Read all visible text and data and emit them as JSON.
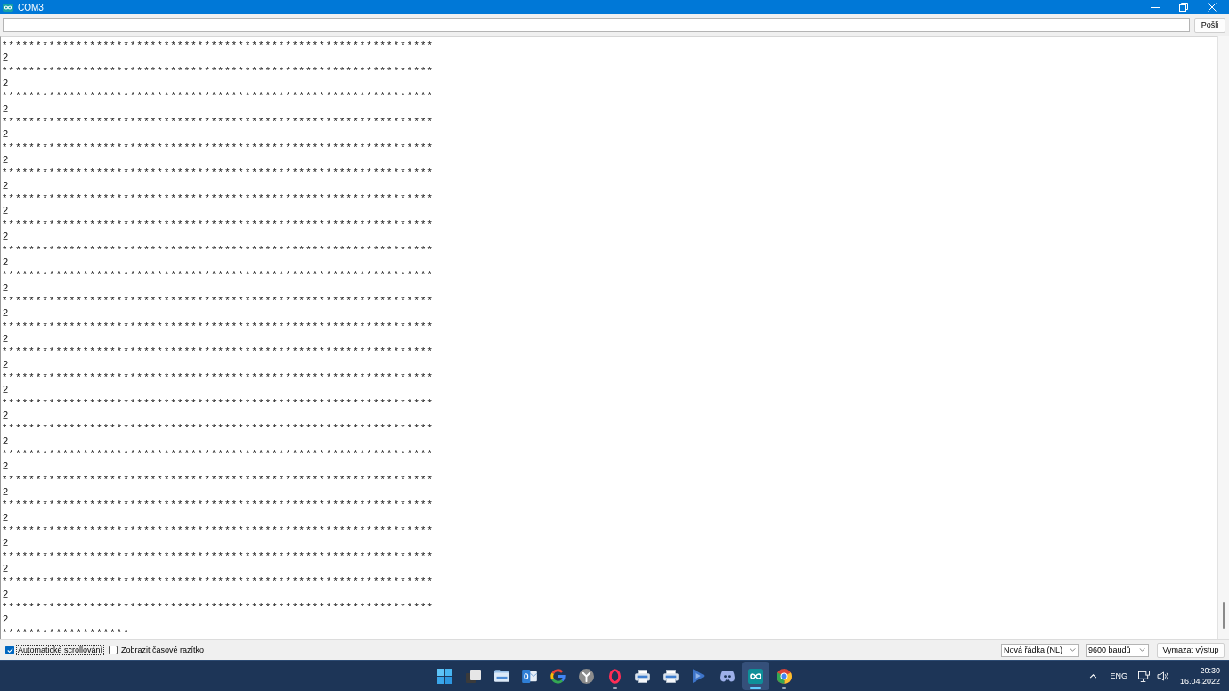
{
  "window": {
    "title": "COM3"
  },
  "send_bar": {
    "button": "Pošli"
  },
  "output": {
    "lines": [
      "****************************************************************",
      "2",
      "****************************************************************",
      "2",
      "****************************************************************",
      "2",
      "****************************************************************",
      "2",
      "****************************************************************",
      "2",
      "****************************************************************",
      "2",
      "****************************************************************",
      "2",
      "****************************************************************",
      "2",
      "****************************************************************",
      "2",
      "****************************************************************",
      "2",
      "****************************************************************",
      "2",
      "****************************************************************",
      "2",
      "****************************************************************",
      "2",
      "****************************************************************",
      "2",
      "****************************************************************",
      "2",
      "****************************************************************",
      "2",
      "****************************************************************",
      "2",
      "****************************************************************",
      "2",
      "****************************************************************",
      "2",
      "****************************************************************",
      "2",
      "****************************************************************",
      "2",
      "****************************************************************",
      "2",
      "****************************************************************",
      "2",
      "*******************"
    ]
  },
  "options": {
    "autoscroll": {
      "label": "Automatické scrollování",
      "checked": true,
      "focused": true
    },
    "timestamp": {
      "label": "Zobrazit časové razítko",
      "checked": false,
      "focused": false
    },
    "line_ending": "Nová řádka (NL)",
    "baud_rate": "9600 baudů",
    "clear_button": "Vymazat výstup"
  },
  "taskbar": {
    "apps": [
      {
        "kind": "start",
        "running": false,
        "selected": false
      },
      {
        "kind": "taskview",
        "running": false,
        "selected": false
      },
      {
        "kind": "folder",
        "running": false,
        "selected": false
      },
      {
        "kind": "mail",
        "running": false,
        "selected": false
      },
      {
        "kind": "letterg",
        "running": false,
        "selected": false
      },
      {
        "kind": "branch",
        "running": false,
        "selected": false
      },
      {
        "kind": "ring",
        "running": true,
        "selected": false
      },
      {
        "kind": "printer",
        "running": false,
        "selected": false
      },
      {
        "kind": "printer",
        "running": false,
        "selected": false
      },
      {
        "kind": "play",
        "running": false,
        "selected": false
      },
      {
        "kind": "controller",
        "running": false,
        "selected": false
      },
      {
        "kind": "infinity",
        "running": true,
        "selected": true
      },
      {
        "kind": "sphere",
        "running": true,
        "selected": false
      }
    ],
    "tray": {
      "language": "ENG",
      "time": "20:30",
      "date": "16.04.2022"
    }
  }
}
